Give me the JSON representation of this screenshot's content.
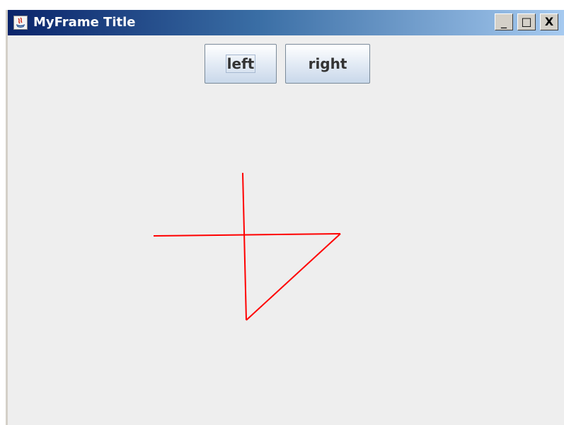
{
  "window": {
    "title": "MyFrame Title",
    "controls": {
      "minimize": "_",
      "maximize": "□",
      "close": "X"
    }
  },
  "buttons": {
    "left_label": "left",
    "right_label": "right"
  },
  "drawing": {
    "stroke_color": "#ff0000"
  }
}
